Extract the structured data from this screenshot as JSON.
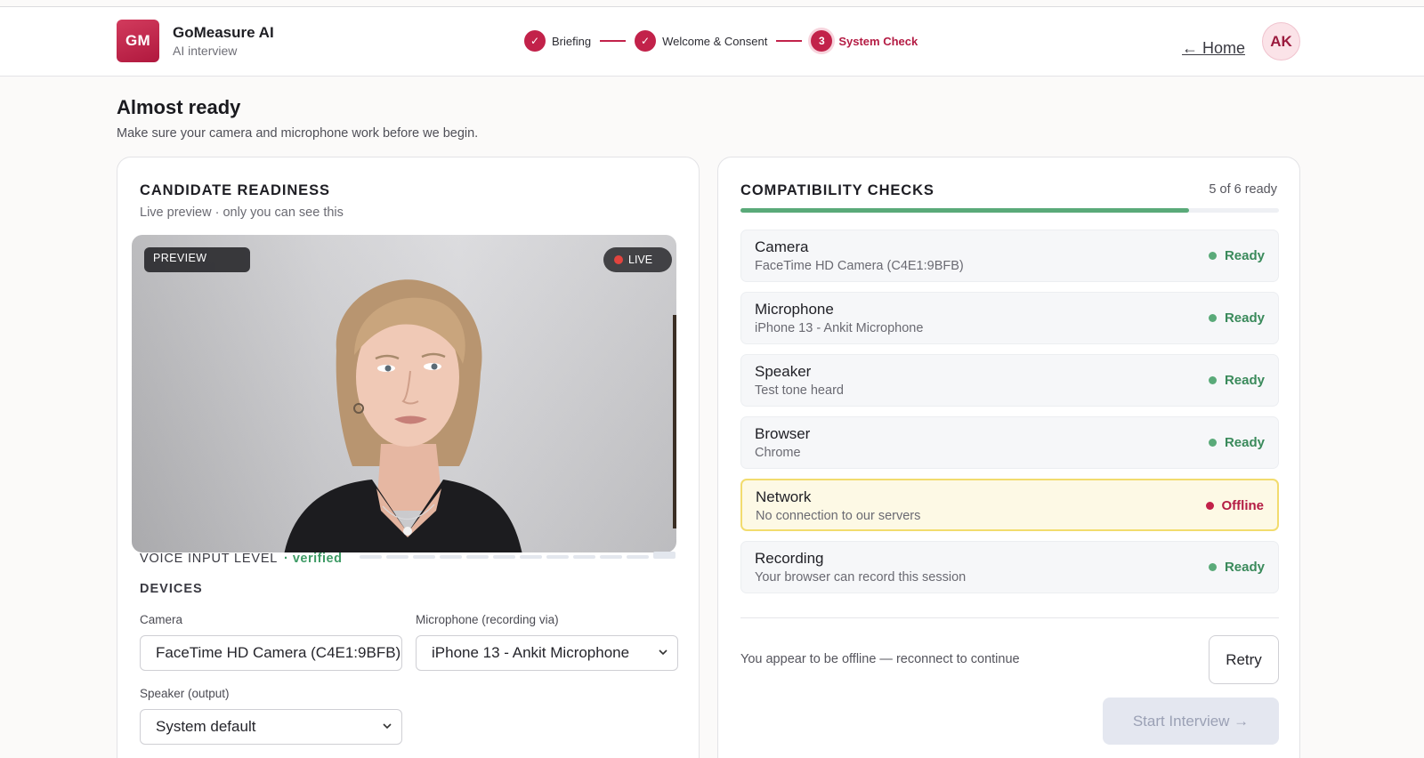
{
  "app": {
    "logo_initials": "GM",
    "name": "GoMeasure AI",
    "subtitle": "AI interview"
  },
  "steps": [
    {
      "label": "Briefing",
      "state": "done",
      "marker": "✓"
    },
    {
      "label": "Welcome & Consent",
      "state": "done",
      "marker": "✓"
    },
    {
      "label": "System Check",
      "state": "current",
      "marker": "3"
    }
  ],
  "nav": {
    "home_label": "← Home",
    "avatar_initials": "AK"
  },
  "page": {
    "title": "Almost ready",
    "subtitle": "Make sure your camera and microphone work before we begin."
  },
  "readiness": {
    "title": "CANDIDATE READINESS",
    "subtitle": "Live preview · only you can see this",
    "preview_badge": "PREVIEW",
    "live_badge": "LIVE",
    "voice_label": "VOICE INPUT LEVEL",
    "voice_status": "· verified",
    "voice_meter_segments": 12,
    "voice_meter_level": 0.0,
    "devices_label": "DEVICES",
    "camera": {
      "label": "Camera",
      "value": "FaceTime HD Camera (C4E1:9BFB)"
    },
    "microphone": {
      "label": "Microphone (recording via)",
      "value": "iPhone 13 - Ankit Microphone"
    },
    "speaker": {
      "label": "Speaker (output)",
      "value": "System default"
    }
  },
  "compatibility": {
    "title": "COMPATIBILITY CHECKS",
    "ready_count": "5 of 6 ready",
    "progress_fraction": 0.833,
    "checks": [
      {
        "name": "Camera",
        "detail": "FaceTime HD Camera (C4E1:9BFB)",
        "status": "Ready",
        "ok": true
      },
      {
        "name": "Microphone",
        "detail": "iPhone 13 - Ankit Microphone",
        "status": "Ready",
        "ok": true
      },
      {
        "name": "Speaker",
        "detail": "Test tone heard",
        "status": "Ready",
        "ok": true
      },
      {
        "name": "Browser",
        "detail": "Chrome",
        "status": "Ready",
        "ok": true
      },
      {
        "name": "Network",
        "detail": "No connection to our servers",
        "status": "Offline",
        "ok": false
      },
      {
        "name": "Recording",
        "detail": "Your browser can record this session",
        "status": "Ready",
        "ok": true
      }
    ],
    "offline_message": "You appear to be offline — reconnect to continue",
    "retry_label": "Retry",
    "start_label": "Start Interview →"
  },
  "colors": {
    "brand": "#c2224a",
    "ready": "#5aaa79",
    "warning_border": "#f2dc6e"
  }
}
